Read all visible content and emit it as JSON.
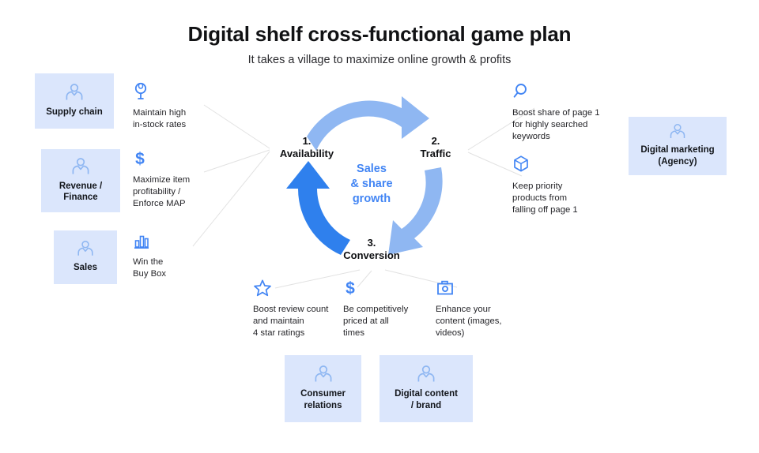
{
  "header": {
    "title": "Digital shelf cross-functional game plan",
    "subtitle": "It takes a village to maximize online growth & profits"
  },
  "colors": {
    "box_bg": "#dbe6fc",
    "accent_blue": "#4285f4",
    "arrow_light": "#8fb7f2",
    "arrow_dark": "#2f80ed",
    "text_dark": "#111214",
    "connector_gray": "#e2e2e2"
  },
  "cycle": {
    "center_text": "Sales\n& share\ngrowth",
    "nodes": [
      {
        "number": "1.",
        "label": "Availability",
        "text": "1.\nAvailability"
      },
      {
        "number": "2.",
        "label": "Traffic",
        "text": "2.\nTraffic"
      },
      {
        "number": "3.",
        "label": "Conversion",
        "text": "3.\nConversion"
      }
    ],
    "arrows": [
      {
        "name": "availability-to-traffic",
        "style": "light"
      },
      {
        "name": "traffic-to-conversion",
        "style": "light"
      },
      {
        "name": "conversion-to-availability",
        "style": "dark"
      }
    ]
  },
  "roles": {
    "left": [
      {
        "label": "Supply chain",
        "icon": "person-icon"
      },
      {
        "label": "Revenue /\nFinance",
        "icon": "person-icon"
      },
      {
        "label": "Sales",
        "icon": "person-icon"
      }
    ],
    "right": [
      {
        "label": "Digital marketing\n(Agency)",
        "icon": "person-icon"
      }
    ],
    "bottom": [
      {
        "label": "Consumer\nrelations",
        "icon": "person-icon"
      },
      {
        "label": "Digital content\n/ brand",
        "icon": "person-icon"
      }
    ]
  },
  "notes": {
    "availability": [
      {
        "icon": "globe-icon",
        "text": "Maintain high\nin-stock rates"
      },
      {
        "icon": "dollar-icon",
        "text": "Maximize item\nprofitability /\nEnforce MAP"
      },
      {
        "icon": "bar-chart-icon",
        "text": "Win the\nBuy Box"
      }
    ],
    "traffic": [
      {
        "icon": "search-icon",
        "text": "Boost share of page 1\nfor highly searched\nkeywords"
      },
      {
        "icon": "box-icon",
        "text": "Keep priority\nproducts from\nfalling off page 1"
      }
    ],
    "conversion": [
      {
        "icon": "star-icon",
        "text": "Boost review count\nand maintain\n4 star ratings"
      },
      {
        "icon": "dollar-icon",
        "text": "Be competitively\npriced at all\ntimes"
      },
      {
        "icon": "camera-icon",
        "text": "Enhance your\ncontent (images,\nvideos)"
      }
    ]
  }
}
